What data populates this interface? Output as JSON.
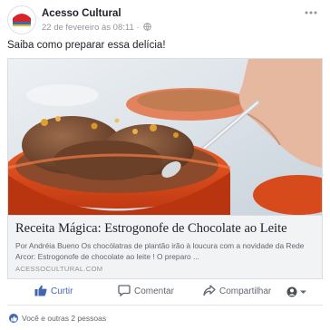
{
  "post": {
    "page_name": "Acesso Cultural",
    "timestamp": "22 de fevereiro às 08:11",
    "meta_separator": " · ",
    "text": "Saiba como preparar essa delícia!"
  },
  "link_preview": {
    "title": "Receita Mágica: Estrogonofe de Chocolate ao Leite",
    "description": "Por Andréia Bueno Os chocólatras de plantão irão à loucura com a novidade da Rede Arcor: Estrogonofe de chocolate ao leite ! O preparo ...",
    "domain": "ACESSOCULTURAL.COM"
  },
  "actions": {
    "like": "Curtir",
    "comment": "Comentar",
    "share": "Compartilhar"
  },
  "reactions": {
    "text": "Você e outras 2 pessoas"
  },
  "colors": {
    "brand_blue": "#4267b2",
    "secondary_text": "#606770",
    "bowl_orange": "#e0481a"
  },
  "icons": [
    "globe-icon",
    "more-options-icon",
    "like-icon",
    "comment-icon",
    "share-icon",
    "reaction-selector-icon"
  ]
}
